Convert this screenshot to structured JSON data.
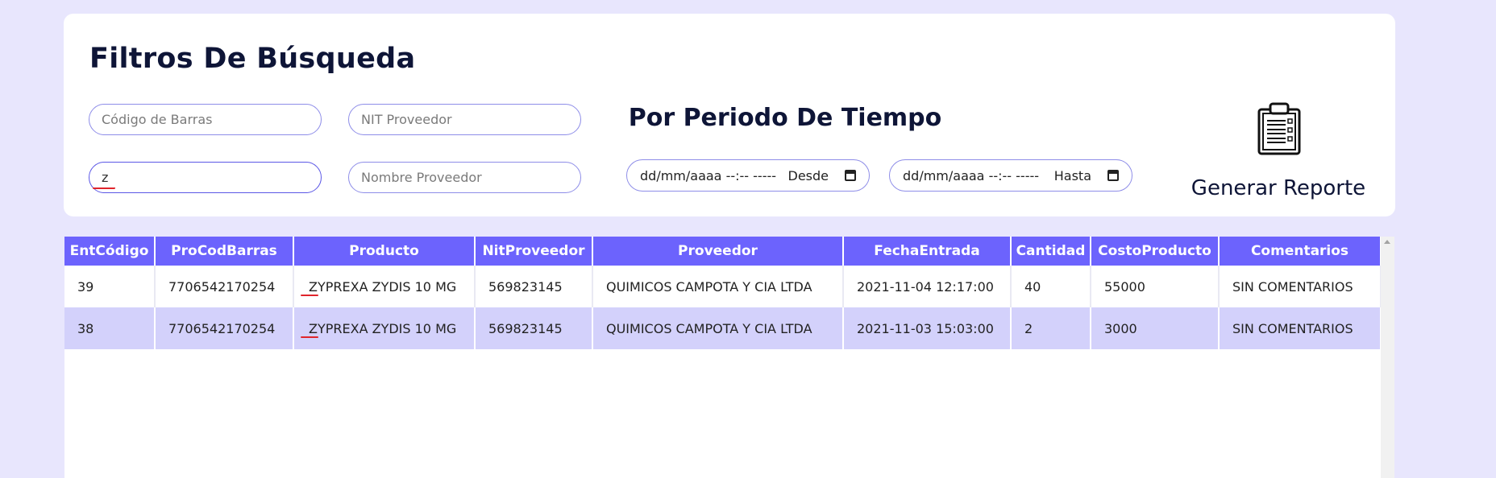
{
  "filters": {
    "title": "Filtros De Búsqueda",
    "barcode_placeholder": "Código de Barras",
    "nit_placeholder": "NIT Proveedor",
    "product_value": "z",
    "supplier_name_placeholder": "Nombre Proveedor",
    "period_title": "Por Periodo De Tiempo",
    "date_mask": "dd/mm/aaaa --:-- -----",
    "from_label": "Desde",
    "to_label": "Hasta",
    "report_label": "Generar Reporte",
    "report_icon": "clipboard-checklist-icon"
  },
  "table": {
    "columns": [
      "EntCódigo",
      "ProCodBarras",
      "Producto",
      "NitProveedor",
      "Proveedor",
      "FechaEntrada",
      "Cantidad",
      "CostoProducto",
      "Comentarios"
    ],
    "rows": [
      [
        "39",
        "7706542170254",
        "ZYPREXA ZYDIS 10 MG",
        "569823145",
        "QUIMICOS CAMPOTA Y CIA LTDA",
        "2021-11-04 12:17:00",
        "40",
        "55000",
        "SIN COMENTARIOS"
      ],
      [
        "38",
        "7706542170254",
        "ZYPREXA ZYDIS 10 MG",
        "569823145",
        "QUIMICOS CAMPOTA Y CIA LTDA",
        "2021-11-03 15:03:00",
        "2",
        "3000",
        "SIN COMENTARIOS"
      ]
    ]
  },
  "colors": {
    "page_bg": "#e8e6fd",
    "header_bg": "#6c63fd",
    "row_alt_bg": "#d3d1fb",
    "input_border": "#8e8de8",
    "title_text": "#0e1537",
    "spell_error": "#e0242b"
  }
}
